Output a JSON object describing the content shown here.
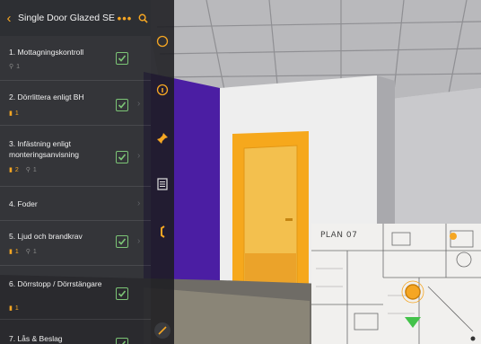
{
  "header": {
    "back_icon": "chevron-left-icon",
    "title": "Single Door Glazed SE...",
    "more_label": "•••",
    "search_icon": "search-icon"
  },
  "checklist": [
    {
      "label": "1. Mottagningskontroll",
      "meta_a": "1",
      "checked": true
    },
    {
      "label": "2. Dörrlittera enligt BH",
      "meta_a": "1",
      "checked": true
    },
    {
      "label": "3. Infästning enligt monteringsanvisning",
      "meta_a": "2",
      "meta_b": "1",
      "checked": true
    },
    {
      "label": "4. Foder",
      "checked": false
    },
    {
      "label": "5. Ljud och brandkrav",
      "meta_a": "1",
      "meta_b": "1",
      "checked": true
    },
    {
      "label": "6. Dörrstopp / Dörrstängare",
      "meta_a": "1",
      "checked": true
    },
    {
      "label": "7. Lås & Beslag",
      "checked": true
    }
  ],
  "toolbar": [
    "compass-icon",
    "info-icon",
    "pin-icon",
    "document-icon",
    "phone-icon",
    "edit-icon"
  ],
  "minimap": {
    "plan_label": "PLAN 07"
  },
  "colors": {
    "accent": "#f5a623",
    "check": "#7cc576",
    "door": "#f6a81c",
    "purple_wall": "#4b1ea3"
  }
}
